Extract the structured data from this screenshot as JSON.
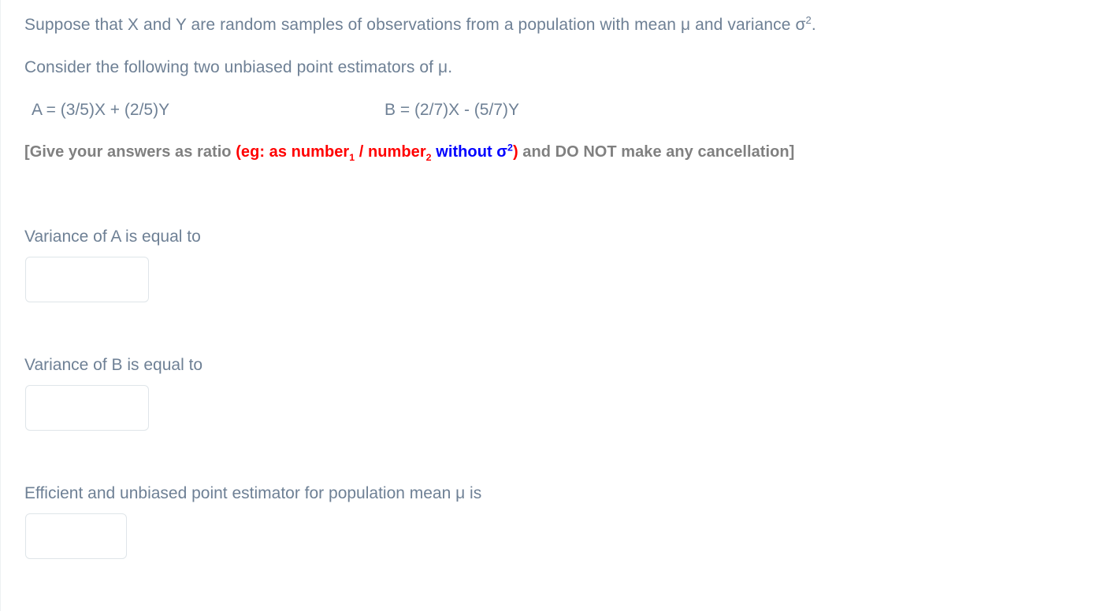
{
  "problem": {
    "intro_prefix": "Suppose that X and Y are random samples of observations from a population with mean μ and variance σ",
    "intro_sup": "2",
    "intro_suffix": ".",
    "consider": "Consider the following two unbiased point estimators of μ.",
    "estimator_a": "A = (3/5)X + (2/5)Y",
    "estimator_b": "B = (2/7)X - (5/7)Y"
  },
  "instruction": {
    "part1_gray": "[Give your answers as ratio ",
    "part2_red_a": "(eg: as number",
    "part2_red_sub1": "1",
    "part2_red_b": " / number",
    "part2_red_sub2": "2",
    "part3_blue": " without σ",
    "part3_blue_sup": "2",
    "part4_red": ")",
    "part5_gray": " and DO NOT make any cancellation]",
    "colors": {
      "gray": "#808080",
      "red": "#ff0000",
      "blue": "#0000ff"
    }
  },
  "questions": [
    {
      "label": "Variance of A is equal to",
      "value": "",
      "placeholder": "",
      "width": "wide"
    },
    {
      "label": "Variance of B is equal to",
      "value": "",
      "placeholder": "",
      "width": "wide"
    },
    {
      "label": "Efficient and unbiased point estimator for population mean μ is",
      "value": "",
      "placeholder": "",
      "width": "narrow"
    }
  ],
  "theme": {
    "text_color": "#6e8095",
    "input_border": "#dfe5e9",
    "background": "#ffffff"
  }
}
